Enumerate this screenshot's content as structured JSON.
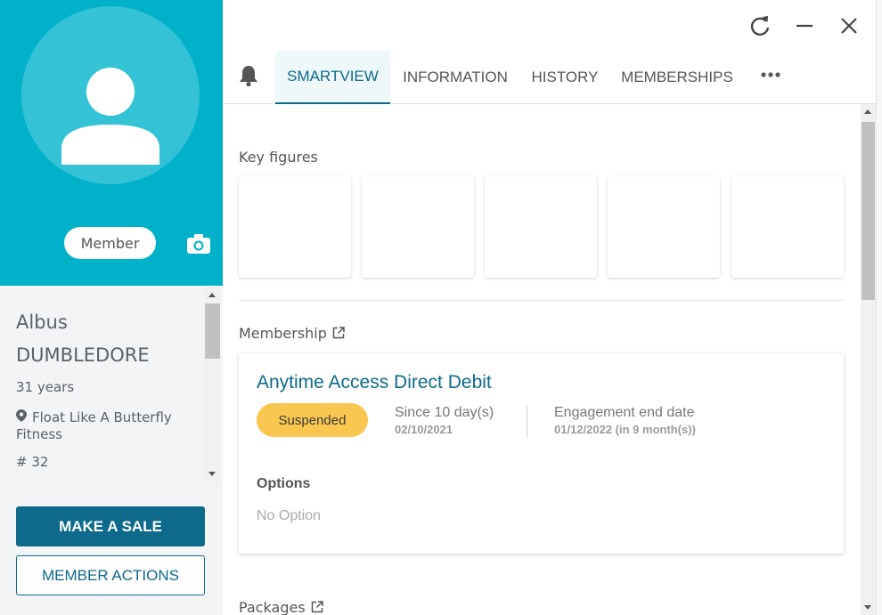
{
  "profile": {
    "role_label": "Member",
    "first_name": "Albus",
    "last_name": "DUMBLEDORE",
    "age": "31 years",
    "club": "Float Like A Butterfly Fitness",
    "member_number": "# 32",
    "hero_color": "#00b1c9"
  },
  "actions": {
    "make_sale": "MAKE A SALE",
    "member_actions": "MEMBER ACTIONS"
  },
  "window_controls": [
    "refresh-icon",
    "minimize-icon",
    "close-icon"
  ],
  "tabs": [
    {
      "label": "SMARTVIEW",
      "active": true
    },
    {
      "label": "INFORMATION",
      "active": false
    },
    {
      "label": "HISTORY",
      "active": false
    },
    {
      "label": "MEMBERSHIPS",
      "active": false
    }
  ],
  "sections": {
    "key_figures": "Key figures",
    "membership": "Membership",
    "packages": "Packages"
  },
  "membership": {
    "name": "Anytime Access Direct Debit",
    "status": "Suspended",
    "since_label": "Since 10 day(s)",
    "since_date": "02/10/2021",
    "engagement_label": "Engagement end date",
    "engagement_date": "01/12/2022 (in 9 month(s))",
    "options_title": "Options",
    "options_value": "No Option"
  },
  "colors": {
    "accent": "#0d6a8a",
    "status_suspended": "#f9c650"
  }
}
